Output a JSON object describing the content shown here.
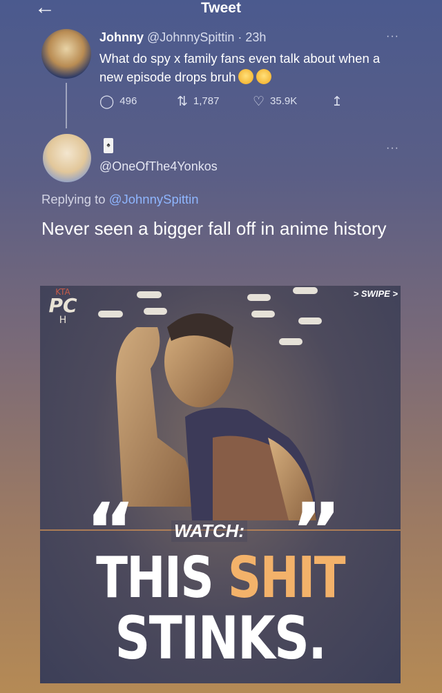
{
  "header": {
    "title": "Tweet",
    "back_icon": "arrow-left-icon"
  },
  "tweet": {
    "name": "Johnny",
    "handle": "@JohnnySpittin",
    "time": "· 23h",
    "text": "What do spy x family fans even talk about when a new episode drops bruh",
    "emojis": [
      "loudly-crying-face",
      "loudly-crying-face"
    ],
    "more_label": "···",
    "actions": {
      "replies": "496",
      "retweets": "1,787",
      "likes": "35.9K",
      "share_icon": "share-icon"
    }
  },
  "reply": {
    "handle": "@OneOfThe4Yonkos",
    "more_label": "···",
    "replying_prefix": "Replying to",
    "replying_to": "@JohnnySpittin",
    "text": "Never seen a bigger fall off in anime history"
  },
  "media": {
    "logo_top": "KTA",
    "logo_main": "PC",
    "logo_bottom": "H",
    "swipe": "> SWIPE >",
    "watch": "WATCH:",
    "line1_word1": "THIS",
    "line1_word2": "SHIT",
    "line2": "STINKS.",
    "colors": {
      "accent": "#f3b26a"
    }
  }
}
